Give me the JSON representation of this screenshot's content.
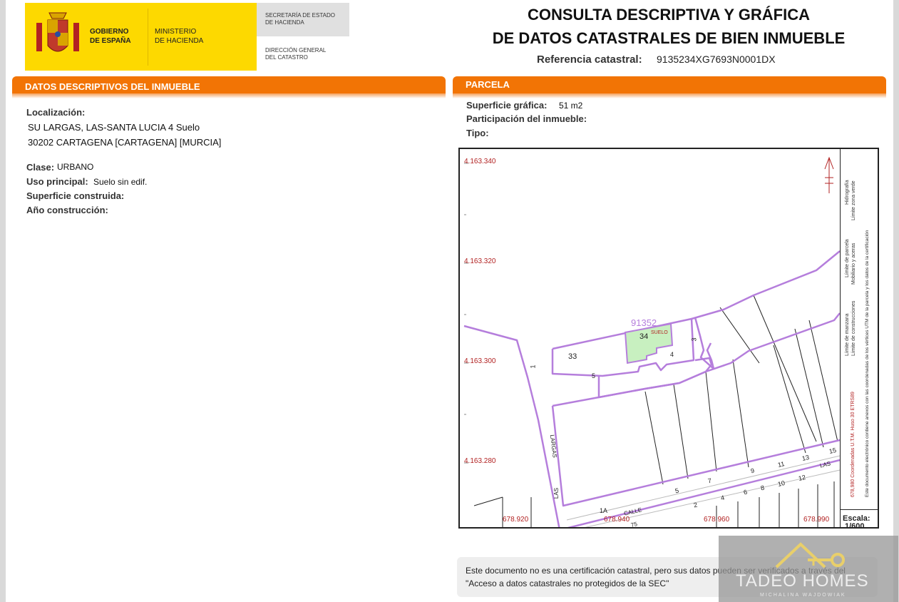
{
  "header": {
    "gov_line1": "GOBIERNO",
    "gov_line2": "DE ESPAÑA",
    "min_line1": "MINISTERIO",
    "min_line2": "DE HACIENDA",
    "sec_line1": "SECRETARÍA DE ESTADO",
    "sec_line2": "DE HACIENDA",
    "dir_line1": "DIRECCIÓN GENERAL",
    "dir_line2": "DEL CATASTRO",
    "title_line1": "CONSULTA DESCRIPTIVA Y GRÁFICA",
    "title_line2": "DE DATOS CATASTRALES DE BIEN INMUEBLE",
    "ref_label": "Referencia catastral:",
    "ref_value": "9135234XG7693N0001DX"
  },
  "left": {
    "section_title": "DATOS DESCRIPTIVOS DEL INMUEBLE",
    "localizacion_label": "Localización:",
    "address_line1": "SU LARGAS, LAS-SANTA LUCIA 4 Suelo",
    "address_line2": "30202 CARTAGENA [CARTAGENA] [MURCIA]",
    "clase_label": "Clase:",
    "clase_value": "URBANO",
    "uso_label": "Uso principal:",
    "uso_value": "Suelo sin edif.",
    "superficie_label": "Superficie construida:",
    "anio_label": "Año construcción:"
  },
  "right": {
    "section_title": "PARCELA",
    "superficie_label": "Superficie gráfica:",
    "superficie_value": "51 m2",
    "participacion_label": "Participación del inmueble:",
    "tipo_label": "Tipo:"
  },
  "map": {
    "y_coords": [
      "4.163.340",
      "4.163.320",
      "4.163.300",
      "4.163.280"
    ],
    "x_coords": [
      "678.920",
      "678.940",
      "678.960",
      "678.990"
    ],
    "parcel_ref": "91352",
    "parcel_numbers": [
      "34",
      "33",
      "4",
      "3",
      "5",
      "1",
      "15",
      "13",
      "11",
      "9",
      "7",
      "5",
      "12",
      "10",
      "8",
      "6",
      "4",
      "2",
      "1A"
    ],
    "suelo_label": "SUELO",
    "street_labels": [
      "LAS",
      "LARGAS",
      "CALLE",
      "LAS",
      "75"
    ],
    "legend": {
      "hidrografia": "Hidrografía",
      "limite_zona_verde": "Límite zona verde",
      "limite_parcela": "Límite de parcela",
      "mobiliario": "Mobiliario y aceras",
      "limite_manzana": "Límite de manzana",
      "limite_construcciones": "Límite de construcciones",
      "coords_note": "678,980 Coordenadas U.T.M. Huso 30 ETRS89",
      "electronic_note": "Este documento electrónico contiene anexos con las coordenadas de los vértices UTM de la parcela y los datos de la certificación"
    },
    "scale_label": "Escala:",
    "scale_value": "1/600",
    "colors": {
      "parcel_line": "#b57edc",
      "highlight": "#c8f0c0",
      "coords": "#b22222"
    }
  },
  "note": {
    "text": "Este documento no es una certificación catastral, pero sus datos pueden ser verificados a través del \"Acceso a datos catastrales no protegidos de la SEC\""
  },
  "watermark": {
    "name": "TADEO HOMES",
    "sub": "MICHALINA WAJDOWIAK"
  }
}
